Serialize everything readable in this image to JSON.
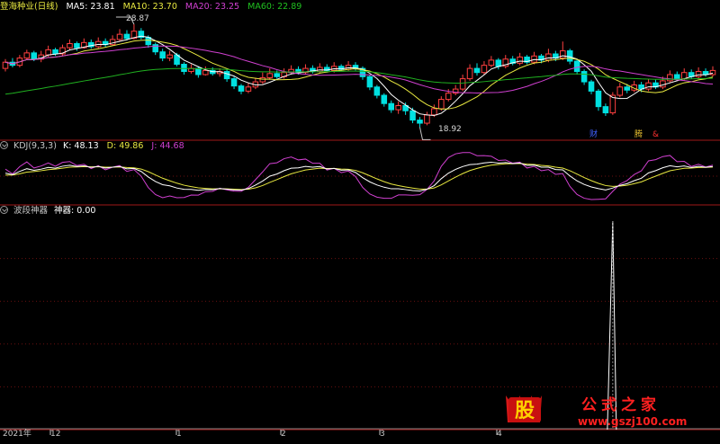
{
  "colors": {
    "up": "#ff4040",
    "down": "#00e0e0",
    "ma5": "#ffffff",
    "ma10": "#e8e840",
    "ma20": "#d040d0",
    "ma60": "#20b020",
    "k": "#ffffff",
    "d": "#e8e840",
    "j": "#d040d0",
    "grid": "#6a1010",
    "sep": "#a01818",
    "spike": "#ffffff"
  },
  "main": {
    "title": "登海种业(日线)",
    "ma5": "MA5: 23.81",
    "ma10": "MA10: 23.70",
    "ma20": "MA20: 23.25",
    "ma60": "MA60: 22.89",
    "high_label": "28.87",
    "low_label": "18.92",
    "marks": [
      "财",
      "腾",
      "&"
    ]
  },
  "kdj": {
    "title": "KDJ(9,3,3)",
    "k": "K: 48.13",
    "d": "D: 49.86",
    "j": "J: 44.68"
  },
  "bottom": {
    "title": "波段神器",
    "value": "神器: 0.00"
  },
  "x_labels": [
    "2021年",
    "12",
    "1",
    "2",
    "3",
    "4"
  ],
  "watermark": {
    "logo": "股",
    "brand": "公式之家",
    "url": "www.gszj100.com"
  },
  "chart_data": [
    {
      "type": "candlestick",
      "title": "登海种业(日线)",
      "ylim": [
        18,
        30
      ],
      "annotations": {
        "high": 28.87,
        "low": 18.92
      },
      "last": {
        "ma5": 23.81,
        "ma10": 23.7,
        "ma20": 23.25,
        "ma60": 22.89
      },
      "candles": [
        [
          24.6,
          25.2,
          25.5,
          24.3
        ],
        [
          25.2,
          24.9,
          25.6,
          24.7
        ],
        [
          24.9,
          25.6,
          25.9,
          24.7
        ],
        [
          25.6,
          26.1,
          26.4,
          25.4
        ],
        [
          26.1,
          25.5,
          26.3,
          25.3
        ],
        [
          25.5,
          25.9,
          26.3,
          25.2
        ],
        [
          25.9,
          26.4,
          26.8,
          25.7
        ],
        [
          26.4,
          26.0,
          26.6,
          25.8
        ],
        [
          26.0,
          26.6,
          26.9,
          25.8
        ],
        [
          26.6,
          27.0,
          27.4,
          26.4
        ],
        [
          27.0,
          26.6,
          27.2,
          26.3
        ],
        [
          26.6,
          27.1,
          27.5,
          26.5
        ],
        [
          27.1,
          26.7,
          27.4,
          26.5
        ],
        [
          26.7,
          27.2,
          27.6,
          26.5
        ],
        [
          27.2,
          26.9,
          27.5,
          26.7
        ],
        [
          26.9,
          27.4,
          27.8,
          26.8
        ],
        [
          27.4,
          27.9,
          28.4,
          27.2
        ],
        [
          27.9,
          27.5,
          28.3,
          27.3
        ],
        [
          27.5,
          28.2,
          28.87,
          27.4
        ],
        [
          28.2,
          27.6,
          28.5,
          27.4
        ],
        [
          27.6,
          26.9,
          27.8,
          26.6
        ],
        [
          26.9,
          26.2,
          27.1,
          25.9
        ],
        [
          26.2,
          25.6,
          26.5,
          25.3
        ],
        [
          25.6,
          25.9,
          26.3,
          25.3
        ],
        [
          25.9,
          25.0,
          26.1,
          24.8
        ],
        [
          25.0,
          24.3,
          25.2,
          24.0
        ],
        [
          24.3,
          24.6,
          25.0,
          24.1
        ],
        [
          24.6,
          24.0,
          24.8,
          23.7
        ],
        [
          24.0,
          24.4,
          24.8,
          23.9
        ],
        [
          24.4,
          24.1,
          24.7,
          23.9
        ],
        [
          24.1,
          24.3,
          24.6,
          23.8
        ],
        [
          24.3,
          23.6,
          24.5,
          23.3
        ],
        [
          23.6,
          22.9,
          23.8,
          22.6
        ],
        [
          22.9,
          22.4,
          23.1,
          22.1
        ],
        [
          22.4,
          22.8,
          23.2,
          22.2
        ],
        [
          22.8,
          23.3,
          23.7,
          22.6
        ],
        [
          23.3,
          23.7,
          24.2,
          23.1
        ],
        [
          23.7,
          24.1,
          24.6,
          23.5
        ],
        [
          24.1,
          23.8,
          24.4,
          23.6
        ],
        [
          23.8,
          24.2,
          24.6,
          23.6
        ],
        [
          24.2,
          24.5,
          24.9,
          24.0
        ],
        [
          24.5,
          24.2,
          24.8,
          24.0
        ],
        [
          24.2,
          24.6,
          25.0,
          24.0
        ],
        [
          24.6,
          24.3,
          24.9,
          24.1
        ],
        [
          24.3,
          24.7,
          25.1,
          24.1
        ],
        [
          24.7,
          24.4,
          25.0,
          24.2
        ],
        [
          24.4,
          24.8,
          25.2,
          24.2
        ],
        [
          24.8,
          24.5,
          25.0,
          24.3
        ],
        [
          24.5,
          24.9,
          25.3,
          24.3
        ],
        [
          24.9,
          24.6,
          25.2,
          24.4
        ],
        [
          24.6,
          23.8,
          24.8,
          23.5
        ],
        [
          23.8,
          22.8,
          24.0,
          22.5
        ],
        [
          22.8,
          22.0,
          23.0,
          21.7
        ],
        [
          22.0,
          21.2,
          22.2,
          20.9
        ],
        [
          21.2,
          20.6,
          21.5,
          20.3
        ],
        [
          20.6,
          21.0,
          21.4,
          20.2
        ],
        [
          21.0,
          20.5,
          21.3,
          20.1
        ],
        [
          20.5,
          19.6,
          20.8,
          19.3
        ],
        [
          19.6,
          19.3,
          19.9,
          18.92
        ],
        [
          19.3,
          20.1,
          20.4,
          19.1
        ],
        [
          20.1,
          20.7,
          21.1,
          19.9
        ],
        [
          20.7,
          21.6,
          21.9,
          20.5
        ],
        [
          21.6,
          22.2,
          22.6,
          21.4
        ],
        [
          22.2,
          22.6,
          23.0,
          22.0
        ],
        [
          22.6,
          23.6,
          24.0,
          22.4
        ],
        [
          23.6,
          24.6,
          25.0,
          23.4
        ],
        [
          24.6,
          24.2,
          25.1,
          23.9
        ],
        [
          24.2,
          24.9,
          25.3,
          24.0
        ],
        [
          24.9,
          25.4,
          25.8,
          24.7
        ],
        [
          25.4,
          24.8,
          25.6,
          24.5
        ],
        [
          24.8,
          25.5,
          25.9,
          24.6
        ],
        [
          25.5,
          25.1,
          25.8,
          24.9
        ],
        [
          25.1,
          25.7,
          26.1,
          24.9
        ],
        [
          25.7,
          25.2,
          25.9,
          25.0
        ],
        [
          25.2,
          25.8,
          26.2,
          25.0
        ],
        [
          25.8,
          25.4,
          26.0,
          25.1
        ],
        [
          25.4,
          26.0,
          26.5,
          25.2
        ],
        [
          26.0,
          25.6,
          26.3,
          25.3
        ],
        [
          25.6,
          26.3,
          27.2,
          25.4
        ],
        [
          26.3,
          25.3,
          26.5,
          25.0
        ],
        [
          25.3,
          24.3,
          25.5,
          24.0
        ],
        [
          24.3,
          23.3,
          24.5,
          23.0
        ],
        [
          23.3,
          22.4,
          23.5,
          22.1
        ],
        [
          22.4,
          20.9,
          22.6,
          20.5
        ],
        [
          20.9,
          20.3,
          21.2,
          20.0
        ],
        [
          20.3,
          22.0,
          22.3,
          20.1
        ],
        [
          22.0,
          22.8,
          23.2,
          21.8
        ],
        [
          22.8,
          22.5,
          23.1,
          22.2
        ],
        [
          22.5,
          23.0,
          23.4,
          22.3
        ],
        [
          23.0,
          22.6,
          23.3,
          22.3
        ],
        [
          22.6,
          23.2,
          23.6,
          22.4
        ],
        [
          23.2,
          22.8,
          23.5,
          22.6
        ],
        [
          22.8,
          23.4,
          23.8,
          22.6
        ],
        [
          23.4,
          24.0,
          24.4,
          23.2
        ],
        [
          24.0,
          23.6,
          24.3,
          23.4
        ],
        [
          23.6,
          24.2,
          24.6,
          23.4
        ],
        [
          24.2,
          23.8,
          24.5,
          23.6
        ],
        [
          23.8,
          24.3,
          24.7,
          23.6
        ],
        [
          24.3,
          24.0,
          24.6,
          23.8
        ],
        [
          24.0,
          24.4,
          24.8,
          23.8
        ]
      ]
    },
    {
      "type": "line",
      "title": "KDJ(9,3,3)",
      "series": [
        {
          "name": "K",
          "last": 48.13
        },
        {
          "name": "D",
          "last": 49.86
        },
        {
          "name": "J",
          "last": 44.68
        }
      ]
    },
    {
      "type": "line",
      "title": "波段神器",
      "series": [
        {
          "name": "神器",
          "last": 0.0,
          "spike_index": 85,
          "spike_value": 100
        }
      ]
    }
  ]
}
